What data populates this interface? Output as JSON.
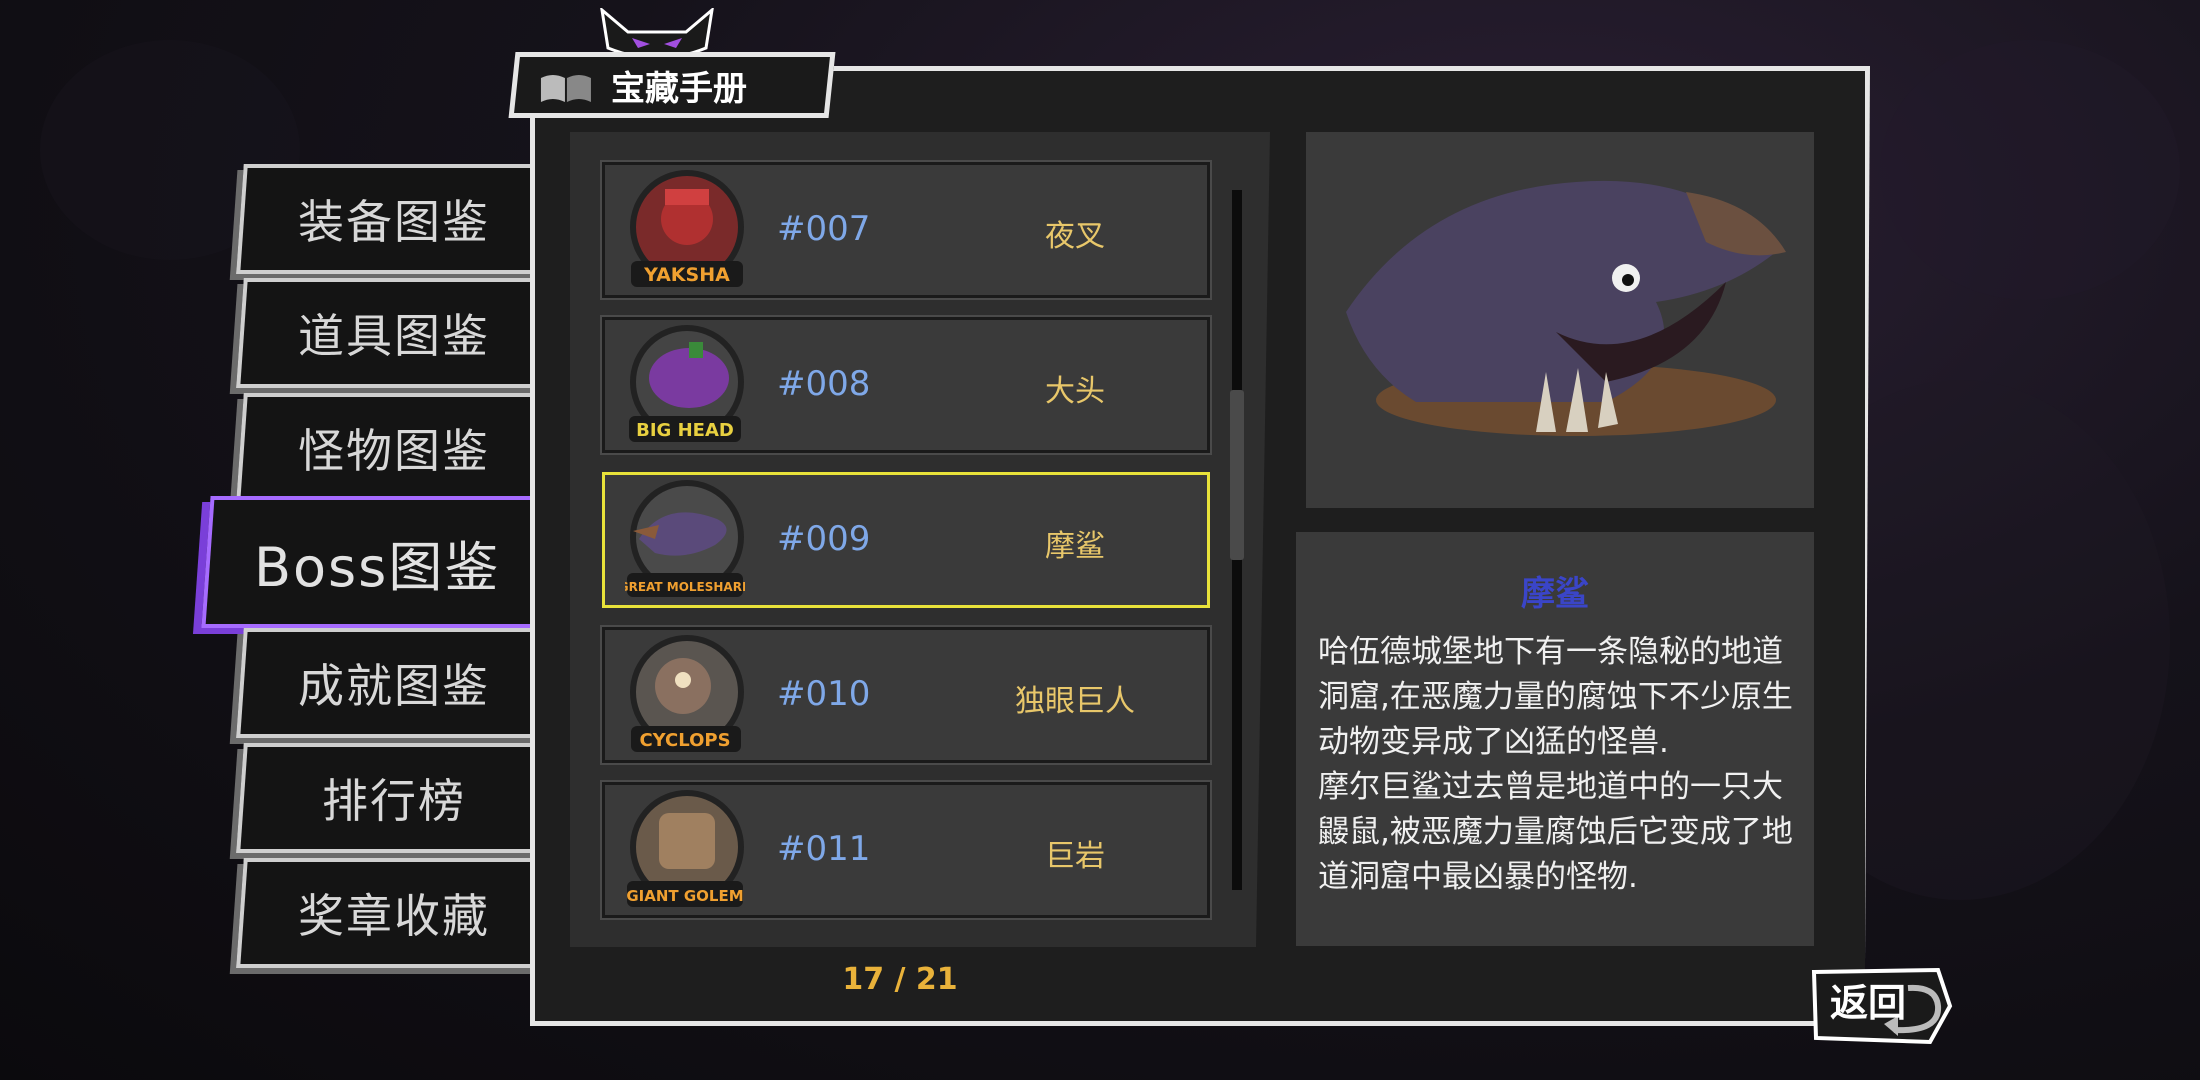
{
  "header": {
    "title": "宝藏手册",
    "book_icon": "book-icon",
    "horns_icon": "demon-horns-icon"
  },
  "tabs": [
    {
      "label": "装备图鉴"
    },
    {
      "label": "道具图鉴"
    },
    {
      "label": "怪物图鉴"
    },
    {
      "label": "Boss图鉴",
      "active": true
    },
    {
      "label": "成就图鉴"
    },
    {
      "label": "排行榜"
    },
    {
      "label": "奖章收藏"
    }
  ],
  "list": {
    "items": [
      {
        "portrait_text": "YAKSHA",
        "number": "#007",
        "name": "夜叉"
      },
      {
        "portrait_text": "BIG HEAD",
        "number": "#008",
        "name": "大头"
      },
      {
        "portrait_text": "GREAT MOLESHARK",
        "number": "#009",
        "name": "摩鲨",
        "selected": true
      },
      {
        "portrait_text": "CYCLOPS",
        "number": "#010",
        "name": "独眼巨人"
      },
      {
        "portrait_text": "GIANT GOLEM",
        "number": "#011",
        "name": "巨岩"
      }
    ],
    "page_indicator": "17 / 21"
  },
  "detail": {
    "name": "摩鲨",
    "description": "哈伍德城堡地下有一条隐秘的地道洞窟,在恶魔力量的腐蚀下不少原生动物变异成了凶猛的怪兽.\n摩尔巨鲨过去曾是地道中的一只大鼹鼠,被恶魔力量腐蚀后它变成了地道洞窟中最凶暴的怪物."
  },
  "back_button": {
    "label": "返回"
  },
  "colors": {
    "accent_purple": "#a66bff",
    "selected_border": "#e8e23a",
    "number_blue": "#7fa8e8",
    "name_gold": "#e8c76a",
    "page_orange": "#e9b23a",
    "detail_title_blue": "#3a45c8"
  }
}
